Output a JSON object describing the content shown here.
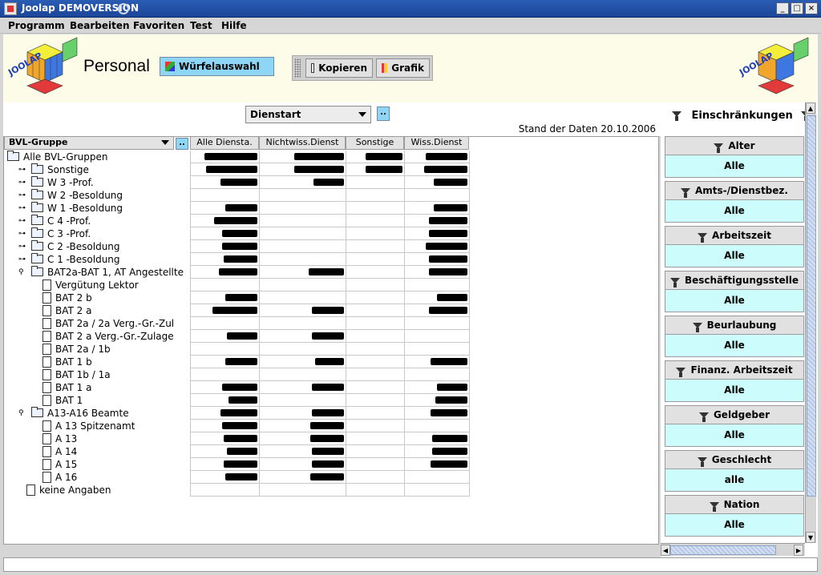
{
  "window": {
    "title": "Joolap DEMOVERSION"
  },
  "menu": [
    "Programm",
    "Bearbeiten",
    "Favoriten",
    "Test",
    "Hilfe"
  ],
  "header": {
    "logo_text": "JOOLAP",
    "page_title": "Personal",
    "cube_button": "Würfelauswahl",
    "copy_button": "Kopieren",
    "chart_button": "Grafik"
  },
  "selector": {
    "dimension": "Dienstart",
    "more": "..",
    "stand": "Stand der Daten 20.10.2006"
  },
  "table": {
    "row_header": "BVL-Gruppe",
    "row_header_more": "..",
    "columns": [
      "Alle Diensta.",
      "Nichtwiss.Dienst",
      "Sonstige",
      "Wiss.Dienst"
    ],
    "rows": [
      {
        "label": "Alle BVL-Gruppen"
      },
      {
        "label": "Sonstige"
      },
      {
        "label": "W 3 -Prof."
      },
      {
        "label": "W 2 -Besoldung"
      },
      {
        "label": "W 1 -Besoldung"
      },
      {
        "label": "C 4 -Prof."
      },
      {
        "label": "C 3 -Prof."
      },
      {
        "label": "C 2 -Besoldung"
      },
      {
        "label": "C 1 -Besoldung"
      },
      {
        "label": "BAT2a-BAT 1, AT Angestellte"
      },
      {
        "label": "Vergütung Lektor"
      },
      {
        "label": "BAT 2 b"
      },
      {
        "label": "BAT 2 a"
      },
      {
        "label": "BAT 2a / 2a Verg.-Gr.-Zul"
      },
      {
        "label": "BAT 2 a Verg.-Gr.-Zulage"
      },
      {
        "label": "BAT 2a / 1b"
      },
      {
        "label": "BAT 1 b"
      },
      {
        "label": "BAT 1b / 1a"
      },
      {
        "label": "BAT 1 a"
      },
      {
        "label": "BAT 1"
      },
      {
        "label": "A13-A16 Beamte"
      },
      {
        "label": "A 13 Spitzenamt"
      },
      {
        "label": "A 13"
      },
      {
        "label": "A 14"
      },
      {
        "label": "A 15"
      },
      {
        "label": "A 16"
      },
      {
        "label": "keine Angaben"
      }
    ]
  },
  "filters": {
    "title": "Einschränkungen",
    "items": [
      {
        "name": "Alter",
        "value": "Alle"
      },
      {
        "name": "Amts-/Dienstbez.",
        "value": "Alle"
      },
      {
        "name": "Arbeitszeit",
        "value": "Alle"
      },
      {
        "name": "Beschäftigungsstelle",
        "value": "Alle"
      },
      {
        "name": "Beurlaubung",
        "value": "Alle"
      },
      {
        "name": "Finanz. Arbeitszeit",
        "value": "Alle"
      },
      {
        "name": "Geldgeber",
        "value": "Alle"
      },
      {
        "name": "Geschlecht",
        "value": "alle"
      },
      {
        "name": "Nation",
        "value": "Alle"
      }
    ]
  },
  "colors": {
    "accent": "#8fd6f6",
    "filter_value_bg": "#ccfcfb",
    "header_bg": "#fdfce8",
    "titlebar": "#2a5db4"
  }
}
